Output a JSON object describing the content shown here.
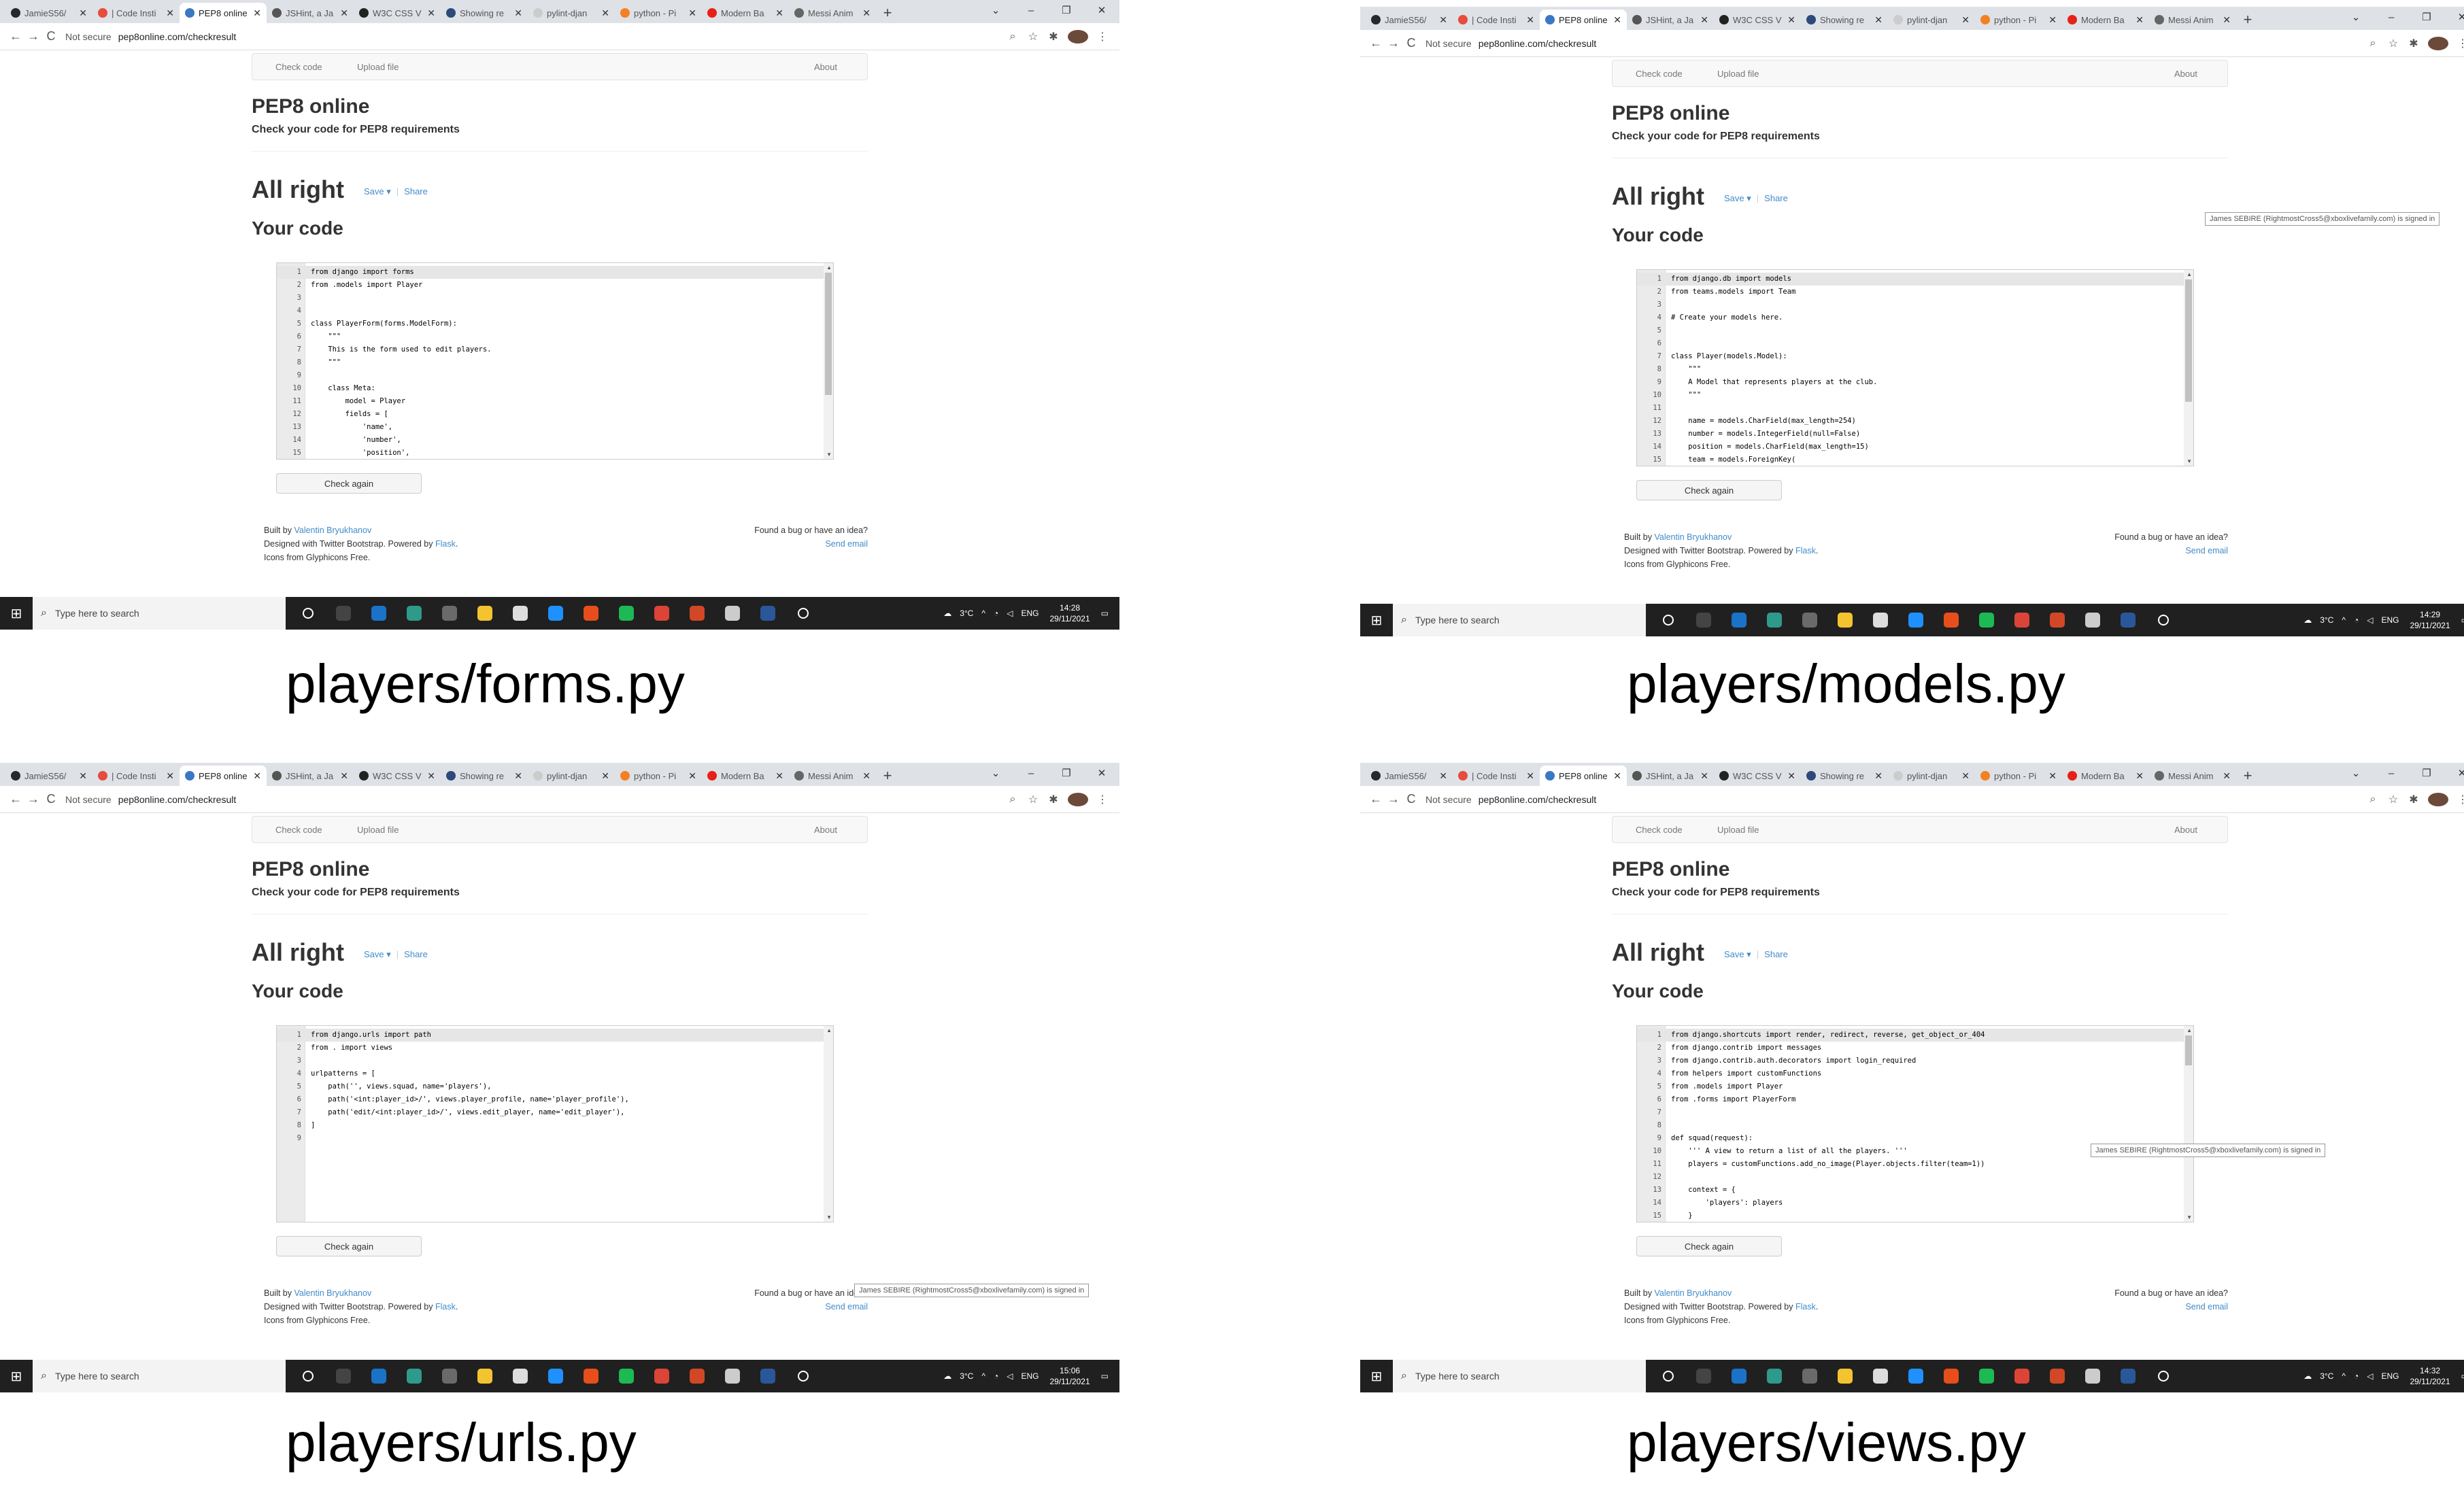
{
  "browser": {
    "tabs": [
      {
        "title": "JamieS56/",
        "color": "#24292e"
      },
      {
        "title": "| Code Insti",
        "color": "#e74c3c"
      },
      {
        "title": "PEP8 online",
        "color": "#3b78c3"
      },
      {
        "title": "JSHint, a Ja",
        "color": "#555555"
      },
      {
        "title": "W3C CSS V",
        "color": "#222222"
      },
      {
        "title": "Showing re",
        "color": "#2c4a7a"
      },
      {
        "title": "pylint-djan",
        "color": "#cccccc"
      },
      {
        "title": "python - Pi",
        "color": "#f48024"
      },
      {
        "title": "Modern Ba",
        "color": "#e62117"
      },
      {
        "title": "Messi Anim",
        "color": "#666666"
      }
    ],
    "new_tab": "+",
    "window_controls": {
      "chevron": "⌄",
      "minimize": "–",
      "maximize": "❐",
      "close": "✕"
    },
    "nav": {
      "back": "←",
      "forward": "→",
      "reload": "C"
    },
    "security_label": "Not secure",
    "url": "pep8online.com/checkresult",
    "toolbar_icons": {
      "search": "⌕",
      "star": "☆",
      "extensions": "✱",
      "menu": "⋮"
    }
  },
  "site": {
    "nav": {
      "check_code": "Check code",
      "upload_file": "Upload file",
      "about": "About"
    },
    "title": "PEP8 online",
    "subtitle": "Check your code for PEP8 requirements",
    "result": "All right",
    "save": "Save ▾",
    "share": "Share",
    "your_code": "Your code",
    "check_again": "Check again",
    "footer": {
      "built_by": "Built by ",
      "author": "Valentin Bryukhanov",
      "designed_with": "Designed with Twitter Bootstrap. Powered by ",
      "flask": "Flask",
      "period": ".",
      "icons": "Icons from Glyphicons Free.",
      "bug": "Found a bug or have an idea?",
      "send_email": "Send email"
    },
    "tooltip": "James SEBIRE (RightmostCross5@xboxlivefamily.com) is signed in"
  },
  "taskbar": {
    "start": "⊞",
    "search_placeholder": "Type here to search",
    "search_icon": "⌕",
    "apps": [
      {
        "name": "cortana",
        "color": "#202020"
      },
      {
        "name": "task-view",
        "color": "#444444"
      },
      {
        "name": "mail",
        "color": "#1a73c8"
      },
      {
        "name": "edge",
        "color": "#2e9a8a"
      },
      {
        "name": "chrome",
        "color": "#6a6a6a"
      },
      {
        "name": "file-explorer",
        "color": "#f4c430"
      },
      {
        "name": "store",
        "color": "#dddddd"
      },
      {
        "name": "ie",
        "color": "#1e90ff"
      },
      {
        "name": "office",
        "color": "#e84e1b"
      },
      {
        "name": "spotify",
        "color": "#1db954"
      },
      {
        "name": "chrome-alt",
        "color": "#db4437"
      },
      {
        "name": "powerpoint",
        "color": "#d24726"
      },
      {
        "name": "paint",
        "color": "#cccccc"
      },
      {
        "name": "word",
        "color": "#2b579a"
      },
      {
        "name": "settings",
        "color": "#202020"
      }
    ],
    "weather": "3°C",
    "language": "ENG",
    "tray_icons": {
      "up": "^",
      "wifi": "◔",
      "volume": "◁",
      "notifications": "▭"
    }
  },
  "screens": [
    {
      "caption": "players/forms.py",
      "time": "14:28",
      "date": "29/11/2021",
      "code": [
        "from django import forms",
        "from .models import Player",
        "",
        "",
        "class PlayerForm(forms.ModelForm):",
        "    \"\"\"",
        "    This is the form used to edit players.",
        "    \"\"\"",
        "",
        "    class Meta:",
        "        model = Player",
        "        fields = [",
        "            'name',",
        "            'number',",
        "            'position',"
      ]
    },
    {
      "caption": "players/models.py",
      "time": "14:29",
      "date": "29/11/2021",
      "code": [
        "from django.db import models",
        "from teams.models import Team",
        "",
        "# Create your models here.",
        "",
        "",
        "class Player(models.Model):",
        "    \"\"\"",
        "    A Model that represents players at the club.",
        "    \"\"\"",
        "",
        "    name = models.CharField(max_length=254)",
        "    number = models.IntegerField(null=False)",
        "    position = models.CharField(max_length=15)",
        "    team = models.ForeignKey("
      ]
    },
    {
      "caption": "players/urls.py",
      "time": "15:06",
      "date": "29/11/2021",
      "code": [
        "from django.urls import path",
        "from . import views",
        "",
        "urlpatterns = [",
        "    path('', views.squad, name='players'),",
        "    path('<int:player_id>/', views.player_profile, name='player_profile'),",
        "    path('edit/<int:player_id>/', views.edit_player, name='edit_player'),",
        "]",
        ""
      ]
    },
    {
      "caption": "players/views.py",
      "time": "14:32",
      "date": "29/11/2021",
      "code": [
        "from django.shortcuts import render, redirect, reverse, get_object_or_404",
        "from django.contrib import messages",
        "from django.contrib.auth.decorators import login_required",
        "from helpers import customFunctions",
        "from .models import Player",
        "from .forms import PlayerForm",
        "",
        "",
        "def squad(request):",
        "    ''' A view to return a list of all the players. '''",
        "    players = customFunctions.add_no_image(Player.objects.filter(team=1))",
        "",
        "    context = {",
        "        'players': players",
        "    }"
      ]
    }
  ]
}
